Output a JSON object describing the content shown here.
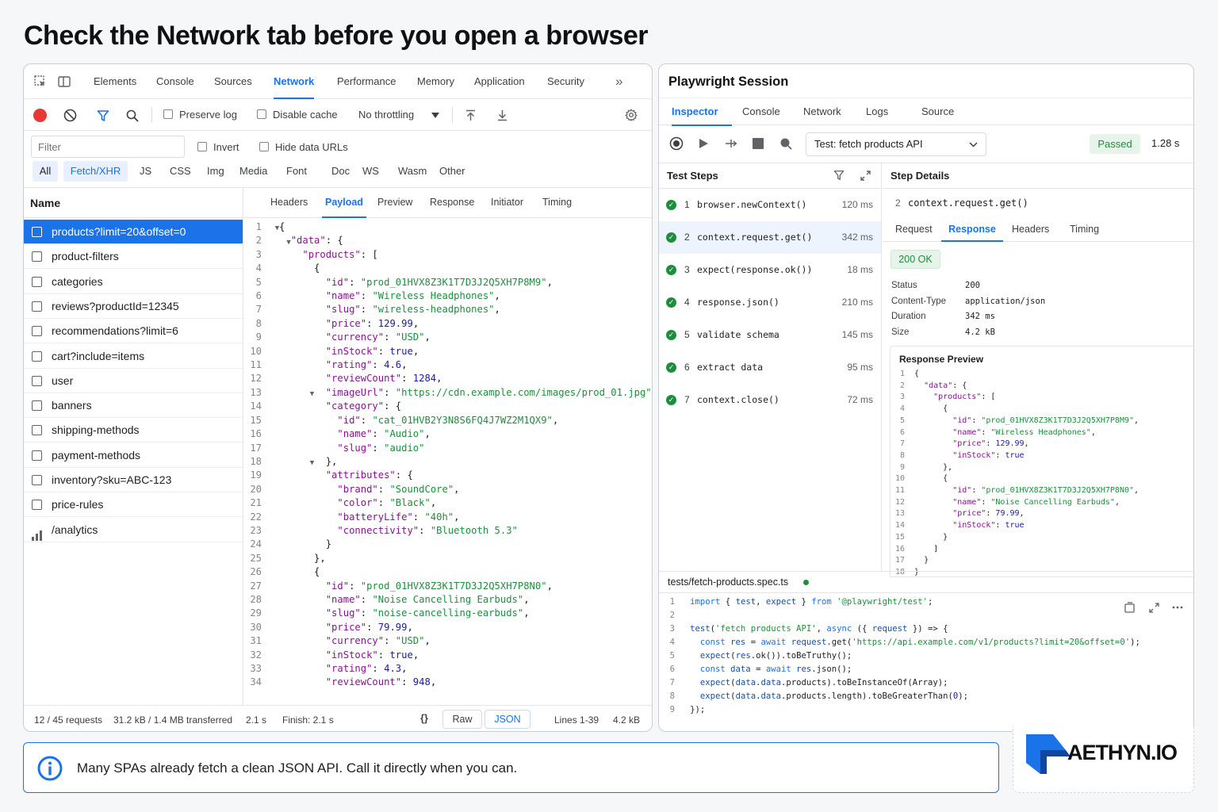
{
  "headline": "Check the Network tab before you open a browser",
  "devtools": {
    "tabs": [
      "Elements",
      "Console",
      "Sources",
      "Network",
      "Performance",
      "Memory",
      "Application",
      "Security"
    ],
    "more": "»",
    "toolbar": {
      "preserve_log": "Preserve log",
      "disable_cache": "Disable cache",
      "throttling": "No throttling"
    },
    "filter": {
      "placeholder": "Filter",
      "invert": "Invert",
      "hide_data_urls": "Hide data URLs"
    },
    "types": [
      "All",
      "Fetch/XHR",
      "JS",
      "CSS",
      "Img",
      "Media",
      "Font",
      "Doc",
      "WS",
      "Wasm",
      "Other"
    ],
    "name_header": "Name",
    "requests": [
      "products?limit=20&offset=0",
      "product-filters",
      "categories",
      "reviews?productId=12345",
      "recommendations?limit=6",
      "cart?include=items",
      "user",
      "banners",
      "shipping-methods",
      "payment-methods",
      "inventory?sku=ABC-123",
      "price-rules",
      "/analytics"
    ],
    "detail_tabs": [
      "Headers",
      "Payload",
      "Preview",
      "Response",
      "Initiator",
      "Timing"
    ],
    "status": {
      "requests": "12 / 45 requests",
      "transferred": "31.2 kB / 1.4 MB transferred",
      "time": "2.1 s",
      "finish": "Finish: 2.1 s",
      "format_btn": "{}",
      "raw": "Raw",
      "json": "JSON",
      "lines": "Lines 1-39",
      "size": "4.2 kB"
    },
    "payload_lines": [
      "{",
      "  \"data\": {",
      "    \"products\": [",
      "      {",
      "        \"id\": \"prod_01HVX8Z3K1T7D3J2Q5XH7P8M9\",",
      "        \"name\": \"Wireless Headphones\",",
      "        \"slug\": \"wireless-headphones\",",
      "        \"price\": 129.99,",
      "        \"currency\": \"USD\",",
      "        \"inStock\": true,",
      "        \"rating\": 4.6,",
      "        \"reviewCount\": 1284,",
      "        \"imageUrl\": \"https://cdn.example.com/images/prod_01.jpg\"",
      "        \"category\": {",
      "          \"id\": \"cat_01HVB2Y3N8S6FQ4J7WZ2M1QX9\",",
      "          \"name\": \"Audio\",",
      "          \"slug\": \"audio\"",
      "        },",
      "        \"attributes\": {",
      "          \"brand\": \"SoundCore\",",
      "          \"color\": \"Black\",",
      "          \"batteryLife\": \"40h\",",
      "          \"connectivity\": \"Bluetooth 5.3\"",
      "        }",
      "      },",
      "      {",
      "        \"id\": \"prod_01HVX8Z3K1T7D3J2Q5XH7P8N0\",",
      "        \"name\": \"Noise Cancelling Earbuds\",",
      "        \"slug\": \"noise-cancelling-earbuds\",",
      "        \"price\": 79.99,",
      "        \"currency\": \"USD\",",
      "        \"inStock\": true,",
      "        \"rating\": 4.3,",
      "        \"reviewCount\": 948,"
    ]
  },
  "playwright": {
    "title": "Playwright Session",
    "tabs": [
      "Inspector",
      "Console",
      "Network",
      "Logs",
      "Source"
    ],
    "test_select": "Test: fetch products API",
    "result": "Passed",
    "duration": "1.28 s",
    "steps_header": "Test Steps",
    "steps": [
      {
        "num": "1",
        "name": "browser.newContext()",
        "ms": "120 ms"
      },
      {
        "num": "2",
        "name": "context.request.get()",
        "ms": "342 ms"
      },
      {
        "num": "3",
        "name": "expect(response.ok())",
        "ms": "18 ms"
      },
      {
        "num": "4",
        "name": "response.json()",
        "ms": "210 ms"
      },
      {
        "num": "5",
        "name": "validate schema",
        "ms": "145 ms"
      },
      {
        "num": "6",
        "name": "extract data",
        "ms": "95 ms"
      },
      {
        "num": "7",
        "name": "context.close()",
        "ms": "72 ms"
      }
    ],
    "details_header": "Step Details",
    "detail_step_num": "2",
    "detail_step": "context.request.get()",
    "detail_tabs": [
      "Request",
      "Response",
      "Headers",
      "Timing"
    ],
    "status_badge": "200 OK",
    "kv": [
      {
        "k": "Status",
        "v": "200"
      },
      {
        "k": "Content-Type",
        "v": "application/json"
      },
      {
        "k": "Duration",
        "v": "342 ms"
      },
      {
        "k": "Size",
        "v": "4.2 kB"
      }
    ],
    "preview_title": "Response Preview",
    "preview_lines": [
      "{",
      "  \"data\": {",
      "    \"products\": [",
      "      {",
      "        \"id\": \"prod_01HVX8Z3K1T7D3J2Q5XH7P8M9\",",
      "        \"name\": \"Wireless Headphones\",",
      "        \"price\": 129.99,",
      "        \"inStock\": true",
      "      },",
      "      {",
      "        \"id\": \"prod_01HVX8Z3K1T7D3J2Q5XH7P8N0\",",
      "        \"name\": \"Noise Cancelling Earbuds\",",
      "        \"price\": 79.99,",
      "        \"inStock\": true",
      "      }",
      "    ]",
      "  }",
      "}"
    ],
    "file": "tests/fetch-products.spec.ts",
    "code_lines": [
      "import { test, expect } from '@playwright/test';",
      "",
      "test('fetch products API', async ({ request }) => {",
      "  const res = await request.get('https://api.example.com/v1/products?limit=20&offset=0');",
      "  expect(res.ok()).toBeTruthy();",
      "  const data = await res.json();",
      "  expect(data.data.products).toBeInstanceOf(Array);",
      "  expect(data.data.products.length).toBeGreaterThan(0);",
      "});"
    ]
  },
  "callout": {
    "text": "Many SPAs already fetch a clean JSON API. Call it directly when you can."
  },
  "brand": {
    "logo_text": "AETHYN.IO"
  },
  "colors": {
    "accent": "#1a73e8",
    "passed": "#1e8e3e",
    "record": "#e53935"
  }
}
